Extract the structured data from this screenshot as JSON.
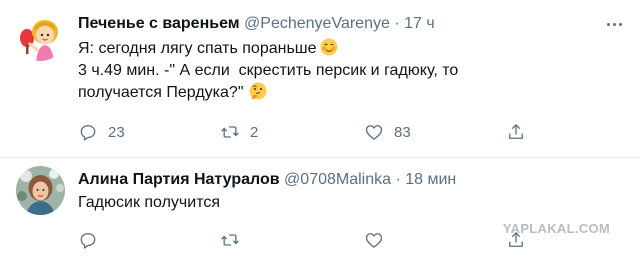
{
  "tweets": [
    {
      "author_name": "Печенье с вареньем",
      "handle": "@PechenyeVarenye",
      "separator": "·",
      "time": "17 ч",
      "avatar_icon": "girl-with-tennis-racket-avatar",
      "lines": [
        "Я: сегодня лягу спать пораньше",
        "3 ч.49 мин. -\" А если  скрестить персик и гадюку, то",
        "получается Пердука?\""
      ],
      "emoji_1": "smiling-face-with-blush-emoji",
      "emoji_2": "thinking-face-emoji",
      "replies": "23",
      "retweets": "2",
      "likes": "83"
    },
    {
      "author_name": "Алина Партия Натуралов",
      "handle": "@0708Malinka",
      "separator": "·",
      "time": "18 мин",
      "avatar_icon": "woman-photo-avatar",
      "lines": [
        "Гадюсик получится"
      ],
      "replies": "",
      "retweets": "",
      "likes": ""
    }
  ],
  "watermark": "YAPLAKAL.COM",
  "colors": {
    "secondary_text": "#5b7083",
    "primary_text": "#0f1419",
    "divider": "#e6ecf0"
  }
}
